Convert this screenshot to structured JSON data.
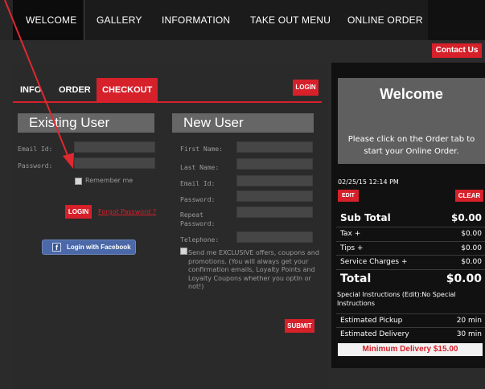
{
  "nav": {
    "items": [
      "WELCOME",
      "GALLERY",
      "INFORMATION",
      "TAKE OUT MENU",
      "ONLINE ORDER"
    ],
    "contact": "Contact Us"
  },
  "tabs": {
    "info": "INFO",
    "order": "ORDER",
    "checkout": "CHECKOUT",
    "login": "LOGIN"
  },
  "existing": {
    "heading": "Existing User",
    "email_label": "Email Id:",
    "password_label": "Password:",
    "remember": "Remember me",
    "login_button": "LOGIN",
    "forgot": "Forgot Password ?",
    "facebook": "Login with Facebook",
    "facebook_icon": "f"
  },
  "newuser": {
    "heading": "New User",
    "first_name": "First Name:",
    "last_name": "Last Name:",
    "email": "Email Id:",
    "password": "Password:",
    "repeat": "Repeat",
    "repeat2": "Password:",
    "telephone": "Telephone:",
    "promo": "Send me EXCLUSIVE offers, coupons and promotions. (You will always get your confirmation emails, Loyalty Points and Loyalty Coupons whether you optIn or not!)",
    "submit": "SUBMIT"
  },
  "cart": {
    "welcome_title": "Welcome",
    "welcome_msg": "Please click on the Order tab to start your Online Order.",
    "datetime": "02/25/15 12:14 PM",
    "edit": "EDIT",
    "clear": "CLEAR",
    "subtotal_label": "Sub Total",
    "subtotal_value": "$0.00",
    "tax_label": "Tax +",
    "tax_value": "$0.00",
    "tips_label": "Tips +",
    "tips_value": "$0.00",
    "service_label": "Service Charges +",
    "service_value": "$0.00",
    "total_label": "Total",
    "total_value": "$0.00",
    "special": "Special Instructions (Edit):No Special Instructions",
    "pickup_label": "Estimated Pickup",
    "pickup_value": "20 min",
    "delivery_label": "Estimated Delivery",
    "delivery_value": "30 min",
    "min_delivery": "Minimum Delivery $15.00"
  },
  "colors": {
    "accent": "#d6202a",
    "annotation": "#e0282f"
  },
  "icons": {
    "checkbox": "checkbox-icon",
    "facebook": "facebook-icon"
  }
}
